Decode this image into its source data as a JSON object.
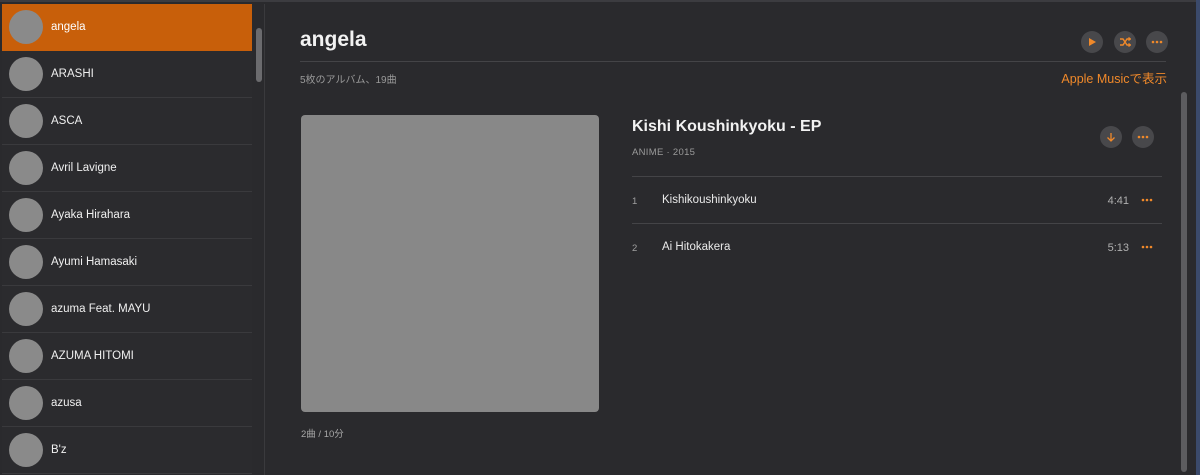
{
  "sidebar": {
    "artists": [
      {
        "name": "angela",
        "selected": true
      },
      {
        "name": "ARASHI"
      },
      {
        "name": "ASCA"
      },
      {
        "name": "Avril Lavigne"
      },
      {
        "name": "Ayaka Hirahara"
      },
      {
        "name": "Ayumi Hamasaki"
      },
      {
        "name": "azuma Feat. MAYU"
      },
      {
        "name": "AZUMA HITOMI"
      },
      {
        "name": "azusa"
      },
      {
        "name": "B'z"
      }
    ]
  },
  "header": {
    "artist": "angela",
    "subtitle": "5枚のアルバム、19曲",
    "apple_music_link": "Apple Musicで表示",
    "buttons": {
      "play": "play-icon",
      "shuffle": "shuffle-icon",
      "more": "more-icon"
    }
  },
  "album": {
    "title": "Kishi Koushinkyoku - EP",
    "genre_year": "ANIME · 2015",
    "summary": "2曲 / 10分",
    "buttons": {
      "download": "download-icon",
      "more": "more-icon"
    },
    "tracks": [
      {
        "number": "1",
        "title": "Kishikoushinkyoku",
        "duration": "4:41"
      },
      {
        "number": "2",
        "title": "Ai Hitokakera",
        "duration": "5:13"
      }
    ]
  },
  "colors": {
    "accent": "#c85f0a",
    "accent_text": "#f0892a",
    "background": "#2a2a2d",
    "artwork_placeholder": "#888888"
  }
}
